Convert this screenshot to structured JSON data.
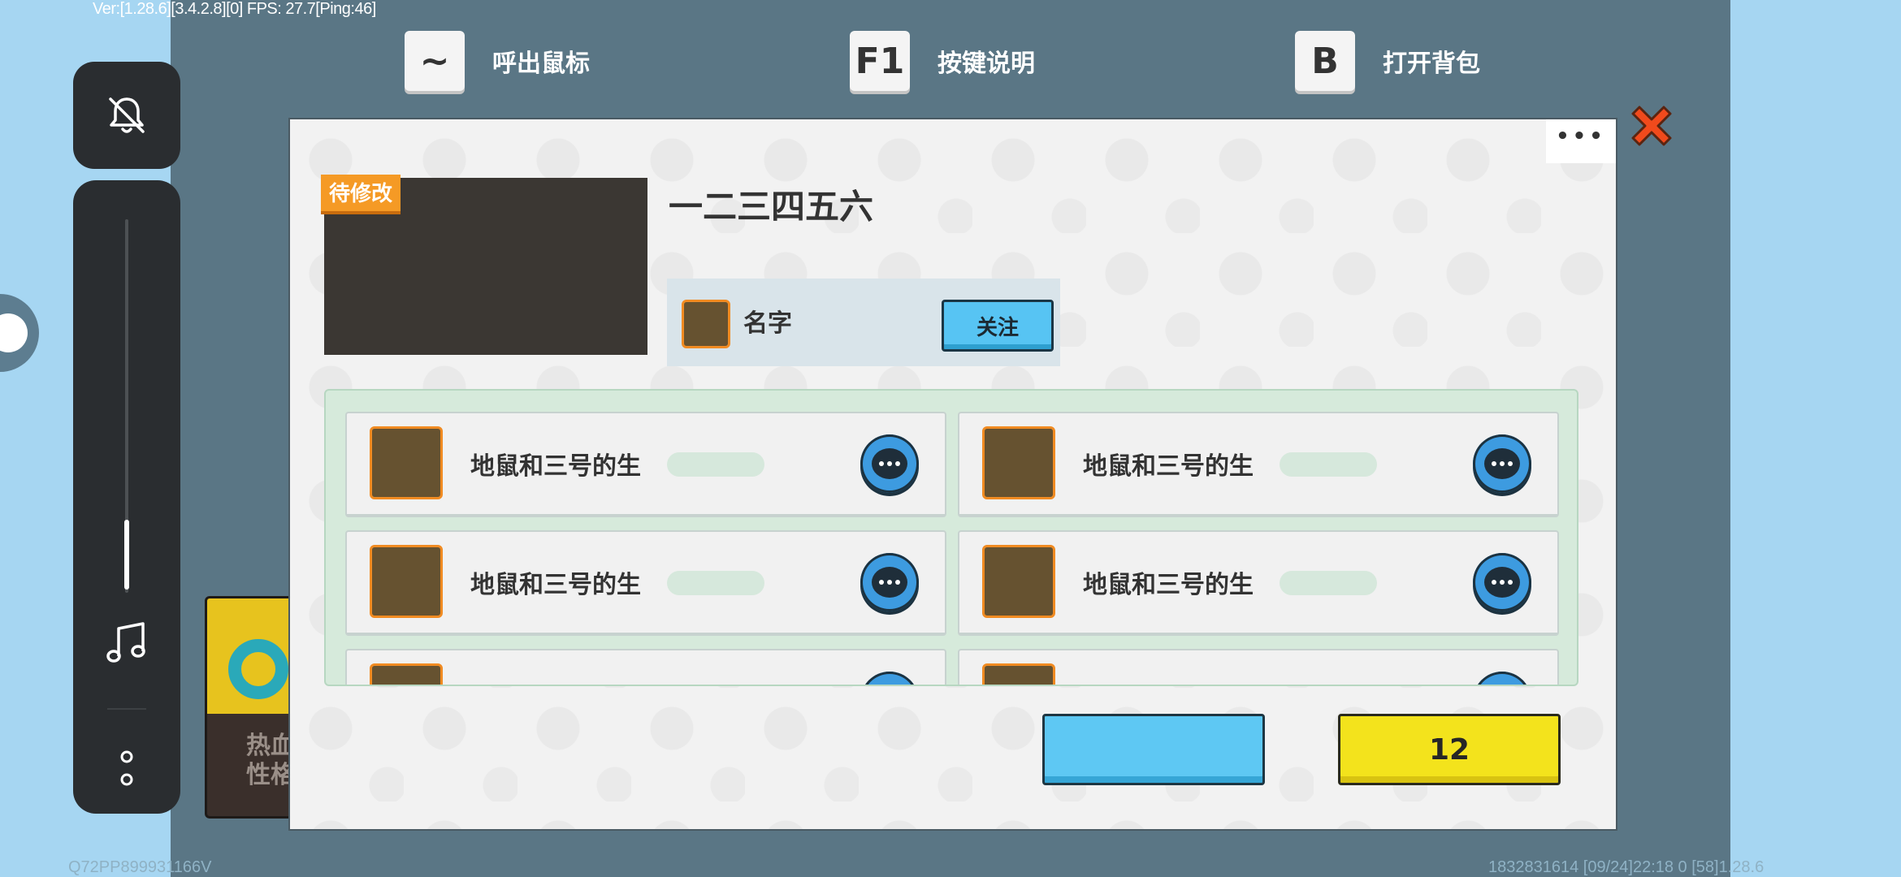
{
  "debug": {
    "version_line": "Ver:[1.28.6][3.4.2.8][0] FPS: 27.7[Ping:46]",
    "device_id": "Q72PP899931166V",
    "bottom_right": "1832831614   [09/24]22:18 0   [58]1.28.6"
  },
  "hints": [
    {
      "key": "~",
      "label": "呼出鼠标"
    },
    {
      "key": "F1",
      "label": "按键说明"
    },
    {
      "key": "B",
      "label": "打开背包"
    }
  ],
  "sidebar": {
    "icons": [
      "bell-off-icon",
      "music-note-icon",
      "more-vertical-icon"
    ],
    "volume_level": 0.18
  },
  "background_card": {
    "text": "热血\n性格"
  },
  "dialog": {
    "more_label": "•••",
    "tag": "待修改",
    "title": "一二三四五六",
    "author": {
      "name": "名字",
      "follow_label": "关注"
    },
    "members": [
      {
        "name": "地鼠和三号的生"
      },
      {
        "name": "地鼠和三号的生"
      },
      {
        "name": "地鼠和三号的生"
      },
      {
        "name": "地鼠和三号的生"
      }
    ],
    "primary_button_label": "",
    "count_button_label": "12"
  },
  "colors": {
    "accent_orange": "#f59a25",
    "button_blue": "#5ec8f3",
    "button_yellow": "#f3e31c",
    "close_red": "#f04a1c"
  }
}
